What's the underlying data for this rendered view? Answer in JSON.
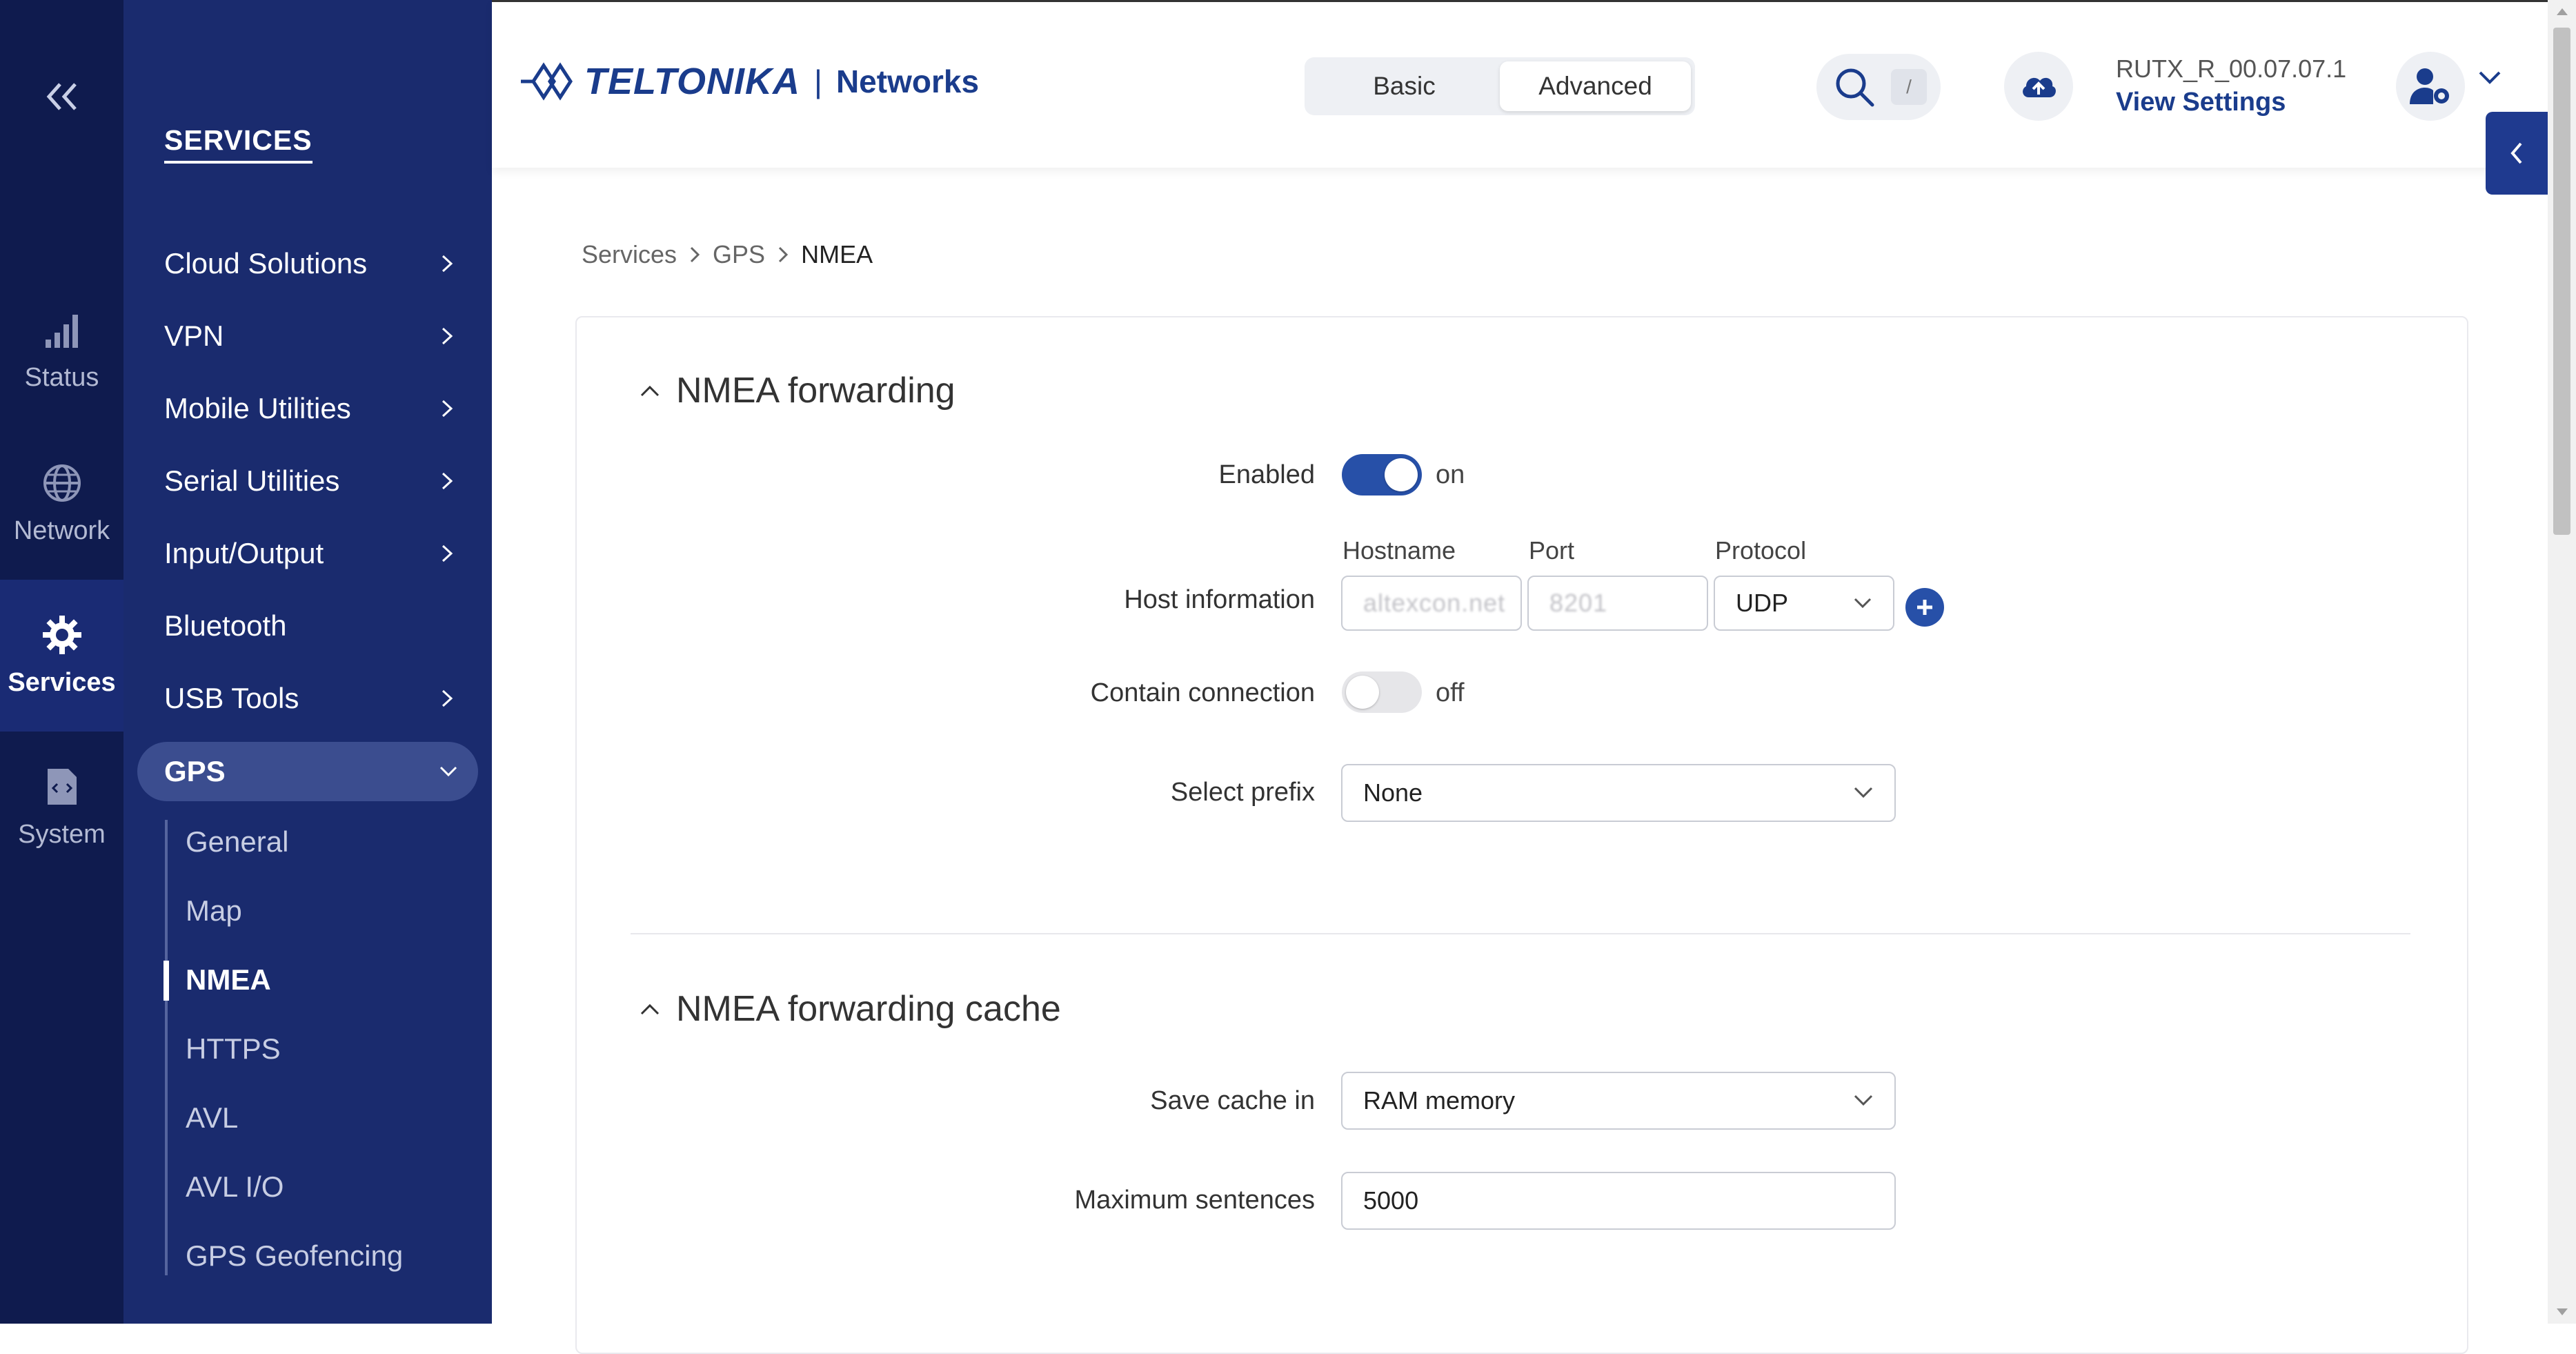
{
  "rail": {
    "items": [
      {
        "label": "Status",
        "icon": "signal-bars-icon"
      },
      {
        "label": "Network",
        "icon": "globe-icon"
      },
      {
        "label": "Services",
        "icon": "gear-icon"
      },
      {
        "label": "System",
        "icon": "system-file-icon"
      }
    ]
  },
  "sidebar": {
    "title": "SERVICES",
    "items": [
      {
        "label": "Cloud Solutions"
      },
      {
        "label": "VPN"
      },
      {
        "label": "Mobile Utilities"
      },
      {
        "label": "Serial Utilities"
      },
      {
        "label": "Input/Output"
      },
      {
        "label": "Bluetooth"
      },
      {
        "label": "USB Tools"
      }
    ],
    "active": {
      "label": "GPS"
    },
    "subitems": [
      {
        "label": "General"
      },
      {
        "label": "Map"
      },
      {
        "label": "NMEA"
      },
      {
        "label": "HTTPS"
      },
      {
        "label": "AVL"
      },
      {
        "label": "AVL I/O"
      },
      {
        "label": "GPS Geofencing"
      }
    ]
  },
  "header": {
    "logo_brand": "TELTONIKA",
    "logo_sep": "|",
    "logo_sub": "Networks",
    "mode_basic": "Basic",
    "mode_advanced": "Advanced",
    "search_key": "/",
    "firmware": "RUTX_R_00.07.07.1",
    "view_settings": "View Settings"
  },
  "breadcrumb": {
    "items": [
      "Services",
      "GPS",
      "NMEA"
    ],
    "sep": ">"
  },
  "forwarding": {
    "title": "NMEA forwarding",
    "enabled_label": "Enabled",
    "enabled_state": "on",
    "host_label": "Host information",
    "hostname_col": "Hostname",
    "port_col": "Port",
    "protocol_col": "Protocol",
    "hostname_value": "altexcon.net",
    "port_value": "8201",
    "protocol_value": "UDP",
    "contain_label": "Contain connection",
    "contain_state": "off",
    "prefix_label": "Select prefix",
    "prefix_value": "None"
  },
  "cache": {
    "title": "NMEA forwarding cache",
    "save_label": "Save cache in",
    "save_value": "RAM memory",
    "max_label": "Maximum sentences",
    "max_value": "5000"
  },
  "colors": {
    "rail": "#0f1b4e",
    "sidebar": "#1a2b6e",
    "accent": "#2750a8"
  }
}
